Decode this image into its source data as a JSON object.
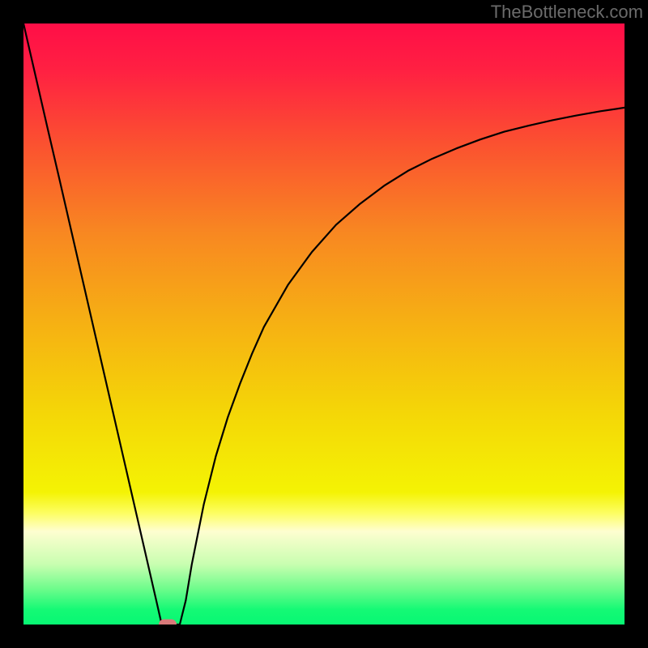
{
  "watermark": "TheBottleneck.com",
  "chart_data": {
    "type": "line",
    "title": "",
    "xlabel": "",
    "ylabel": "",
    "xlim": [
      0,
      100
    ],
    "ylim": [
      0,
      100
    ],
    "grid": false,
    "legend": false,
    "gradient": {
      "stops": [
        {
          "pos": 0.0,
          "color": "#ff0e47"
        },
        {
          "pos": 0.08,
          "color": "#ff2142"
        },
        {
          "pos": 0.2,
          "color": "#fb5130"
        },
        {
          "pos": 0.35,
          "color": "#f88821"
        },
        {
          "pos": 0.5,
          "color": "#f6b113"
        },
        {
          "pos": 0.65,
          "color": "#f4d707"
        },
        {
          "pos": 0.78,
          "color": "#f4f304"
        },
        {
          "pos": 0.815,
          "color": "#fdfe63"
        },
        {
          "pos": 0.845,
          "color": "#fefed0"
        },
        {
          "pos": 0.9,
          "color": "#c8feb0"
        },
        {
          "pos": 0.94,
          "color": "#6ffc8c"
        },
        {
          "pos": 0.975,
          "color": "#15f975"
        },
        {
          "pos": 1.0,
          "color": "#07f873"
        }
      ]
    },
    "series": [
      {
        "name": "bottleneck-curve",
        "x": [
          0,
          2,
          4,
          6,
          8,
          10,
          12,
          14,
          16,
          18,
          20,
          22,
          23,
          24,
          25,
          26,
          27,
          28,
          30,
          32,
          34,
          36,
          38,
          40,
          44,
          48,
          52,
          56,
          60,
          64,
          68,
          72,
          76,
          80,
          84,
          88,
          92,
          96,
          100
        ],
        "y": [
          100,
          91.3,
          82.6,
          74.0,
          65.3,
          56.6,
          47.9,
          39.2,
          30.5,
          21.8,
          13.1,
          4.4,
          0.0,
          0.0,
          0.0,
          0.0,
          4.0,
          10.0,
          20.0,
          28.0,
          34.5,
          40.0,
          45.0,
          49.5,
          56.5,
          62.0,
          66.5,
          70.0,
          73.0,
          75.5,
          77.5,
          79.2,
          80.7,
          82.0,
          83.0,
          83.9,
          84.7,
          85.4,
          86.0
        ]
      }
    ],
    "marker": {
      "x": 24.0,
      "y": 0.0,
      "color": "#d97a7a"
    }
  }
}
